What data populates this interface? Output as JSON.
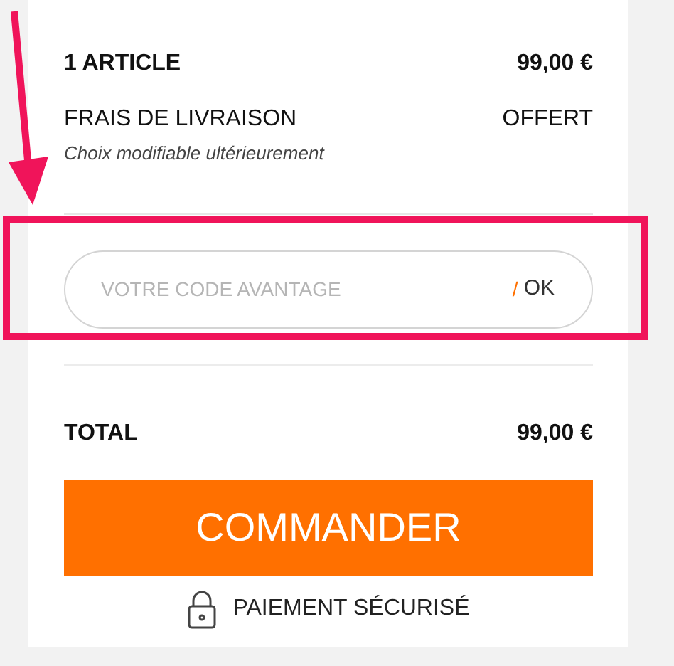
{
  "summary": {
    "lines": [
      {
        "label": "1 ARTICLE",
        "value": "99,00 €",
        "kind": "strong"
      },
      {
        "label": "FRAIS DE LIVRAISON",
        "value": "OFFERT",
        "kind": "plain",
        "note": "Choix modifiable ultérieurement"
      }
    ]
  },
  "promo": {
    "placeholder": "VOTRE CODE AVANTAGE",
    "separator": "/",
    "submit": "OK"
  },
  "total": {
    "label": "TOTAL",
    "value": "99,00 €"
  },
  "order_button": "COMMANDER",
  "secure_note": "PAIEMENT SÉCURISÉ"
}
